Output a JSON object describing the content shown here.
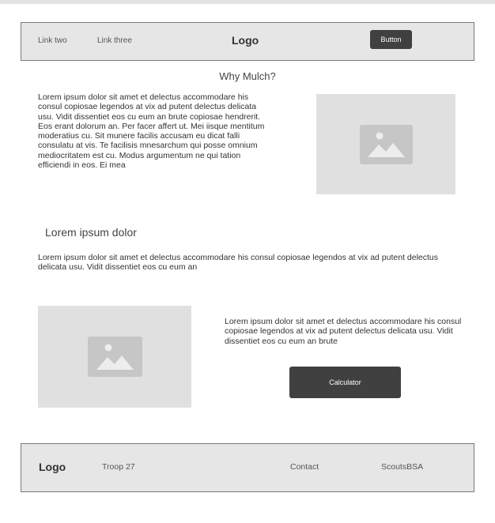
{
  "nav": {
    "links": [
      "Link two",
      "Link three"
    ],
    "logo": "Logo",
    "button_label": "Button"
  },
  "section1": {
    "heading": "Why Mulch?",
    "body": "Lorem ipsum dolor sit amet et delectus accommodare his consul copiosae legendos at vix ad putent delectus delicata usu. Vidit dissentiet eos cu eum an brute copiosae hendrerit. Eos erant dolorum an. Per facer affert ut. Mei iisque mentitum moderatius cu. Sit munere facilis accusam eu dicat falli consulatu at vis. Te facilisis mnesarchum qui posse omnium mediocritatem est cu. Modus argumentum ne qui tation efficiendi in eos. Ei mea",
    "image_icon": "image-placeholder-icon"
  },
  "section2": {
    "heading": "Lorem ipsum dolor",
    "body": "Lorem ipsum dolor sit amet et delectus accommodare his consul copiosae legendos at vix ad putent delectus delicata usu. Vidit dissentiet eos cu eum an"
  },
  "section3": {
    "body": "Lorem ipsum dolor sit amet et delectus accommodare his consul copiosae legendos at vix ad putent delectus delicata usu. Vidit dissentiet eos cu eum an brute",
    "button_label": "Calculator",
    "image_icon": "image-placeholder-icon"
  },
  "footer": {
    "logo": "Logo",
    "troop": "Troop 27",
    "contact": "Contact",
    "scouts": "ScoutsBSA"
  },
  "colors": {
    "background": "#ffffff",
    "panel": "#e6e6e6",
    "border": "#7a7a7a",
    "button": "#404040",
    "placeholder": "#e0e0e0",
    "placeholder_icon": "#c6c6c6"
  }
}
